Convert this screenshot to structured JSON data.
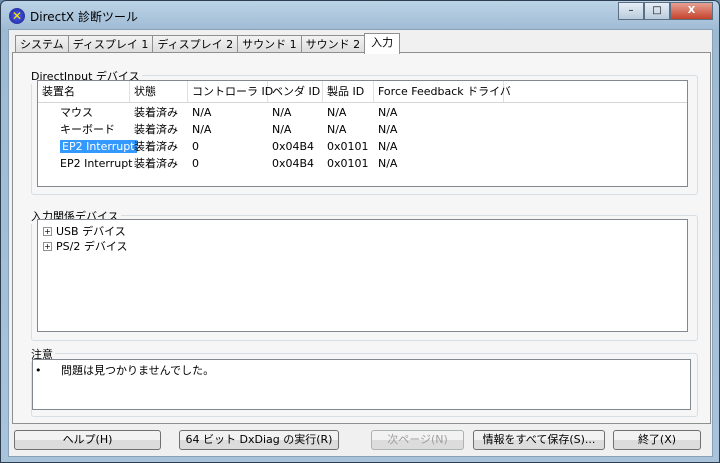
{
  "window": {
    "title": "DirectX 診断ツール",
    "minimize": "–",
    "maximize": "□",
    "close": "X"
  },
  "tabs": [
    "システム",
    "ディスプレイ 1",
    "ディスプレイ 2",
    "サウンド 1",
    "サウンド 2",
    "入力"
  ],
  "directinput": {
    "label": "DirectInput デバイス",
    "columns": [
      "装置名",
      "状態",
      "コントローラ ID",
      "ベンダ ID",
      "製品 ID",
      "Force Feedback ドライバ"
    ],
    "rows": [
      [
        "マウス",
        "装着済み",
        "N/A",
        "N/A",
        "N/A",
        "N/A"
      ],
      [
        "キーボード",
        "装着済み",
        "N/A",
        "N/A",
        "N/A",
        "N/A"
      ],
      [
        "EP2 Interrupt",
        "装着済み",
        "0",
        "0x04B4",
        "0x0101",
        "N/A"
      ],
      [
        "EP2 Interrupt",
        "装着済み",
        "0",
        "0x04B4",
        "0x0101",
        "N/A"
      ]
    ]
  },
  "related": {
    "label": "入力関係デバイス",
    "items": [
      "USB デバイス",
      "PS/2 デバイス"
    ]
  },
  "notes": {
    "label": "注意",
    "bullet": "•",
    "text": "問題は見つかりませんでした。"
  },
  "buttons": {
    "help": "ヘルプ(H)",
    "run64": "64 ビット DxDiag の実行(R)",
    "next": "次ページ(N)",
    "save": "情報をすべて保存(S)...",
    "exit": "終了(X)"
  }
}
